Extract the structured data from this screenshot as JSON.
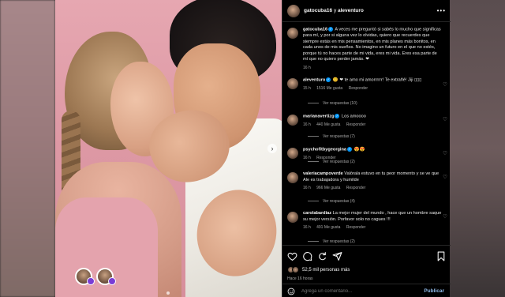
{
  "post": {
    "authors": "gatocuba16",
    "authors_sep": "y",
    "coauthor": "aleventuro",
    "more_glyph": "•••"
  },
  "caption": {
    "user": "gatocuba16",
    "text": "A veces me preguntó si sabés lo mucho que significas para mí, y por si alguna vez lo olvidas, quiero que recuerdes que siempre estás en mis pensamientos, en mis planes más bonitos, en cada unos de mis sueños. No imagino un futuro en el que no estés, porque tú no haces parte de mi vida, eres mi vida. Eres esa parte de mí que no quiero perder jamás. ❤",
    "time": "16 h"
  },
  "comments": [
    {
      "user": "aleventuro",
      "text": "😊 ❤ te amo mi amorrrrrr! Te extrañé! Jiji ▯▯▯",
      "time": "15 h",
      "likes": "1516 Me gusta",
      "reply": "Responder",
      "replies": "Ver respuestas (10)"
    },
    {
      "user": "marianavertizg",
      "text": "Los amoooo",
      "time": "16 h",
      "likes": "440 Me gusta",
      "reply": "Responder",
      "replies": "Ver respuestas (7)"
    },
    {
      "user": "psychofitbygeorgina",
      "text": "😍😍",
      "time": "16 h",
      "likes": "",
      "reply": "Responder",
      "replies": "Ver respuestas (2)"
    },
    {
      "user": "valeriacampoverde",
      "text": "Valórala estuvo en tu peor momento y se ve que Ale es trabajadora y humilde",
      "time": "16 h",
      "likes": "966 Me gusta",
      "reply": "Responder",
      "replies": "Ver respuestas (4)"
    },
    {
      "user": "carolabardiaz",
      "text": "La mejor mujer del mundo , hace que un hombre saque su mejor versión. Porfavor solo no cagues !!!",
      "time": "16 h",
      "likes": "491 Me gusta",
      "reply": "Responder",
      "replies": "Ver respuestas (2)"
    }
  ],
  "footer": {
    "likes_count": "52,5 mil personas más",
    "time_ago": "Hace 16 horas",
    "comment_placeholder": "Agrega un comentario...",
    "publish_label": "Publicar"
  },
  "icons": [
    "heart-icon",
    "comment-icon",
    "share-icon",
    "send-icon",
    "bookmark-icon",
    "emoji-icon",
    "more-icon"
  ],
  "colors": {
    "background": "#000000",
    "text": "#f5f5f5",
    "muted": "#a8a8a8",
    "link": "#0095f6",
    "heart": "#ed4956",
    "photo_bg": "#e6a7b1"
  }
}
